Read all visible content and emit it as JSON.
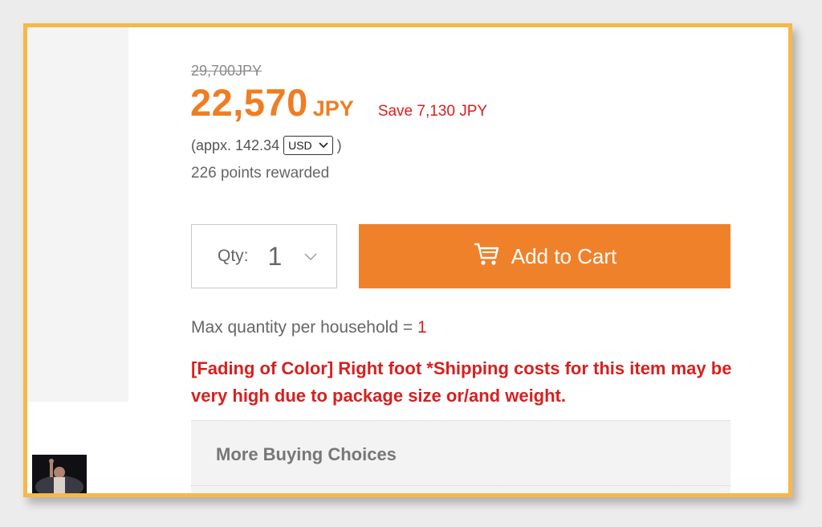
{
  "pricing": {
    "original_price": "29,700JPY",
    "sale_price": "22,570",
    "sale_currency": "JPY",
    "savings": "Save 7,130 JPY",
    "approx_prefix": "(appx. 142.34",
    "approx_suffix": ")",
    "currency_option": "USD",
    "points": "226 points rewarded"
  },
  "quantity": {
    "label": "Qty:",
    "value": "1"
  },
  "cart_button": {
    "label": "Add to Cart",
    "icon": "cart-icon"
  },
  "limits": {
    "max_label": "Max quantity per household = ",
    "max_value": "1"
  },
  "warning": "[Fading of Color] Right foot *Shipping costs for this item may be very high due to package size or/and weight.",
  "buying_choices": {
    "title": "More Buying Choices"
  },
  "colors": {
    "accent": "#ef7d22",
    "button": "#f0812b",
    "alert": "#d7201f",
    "frame": "#f5b84a"
  }
}
